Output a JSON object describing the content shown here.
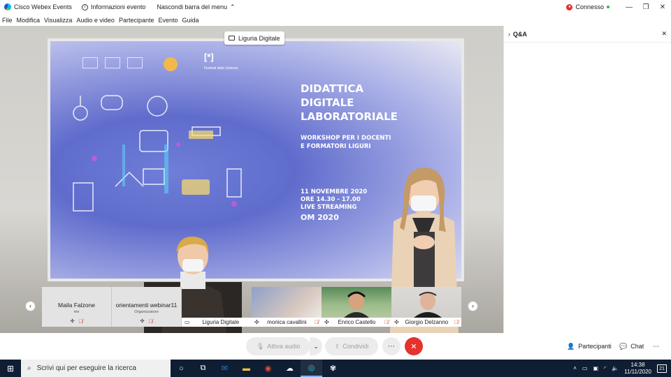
{
  "titlebar": {
    "app_name": "Cisco Webex Events",
    "info_label": "Informazioni evento",
    "hide_menu_label": "Nascondi barra del menu",
    "status_label": "Connesso"
  },
  "menu": [
    "File",
    "Modifica",
    "Visualizza",
    "Audio e video",
    "Partecipante",
    "Evento",
    "Guida"
  ],
  "stage": {
    "tag": "Liguria Digitale",
    "slide": {
      "title": [
        "DIDATTICA",
        "DIGITALE",
        "LABORATORIALE"
      ],
      "subtitle": [
        "WORKSHOP PER I DOCENTI",
        "E FORMATORI LIGURI"
      ],
      "date": [
        "11 NOVEMBRE 2020",
        "ORE 14.30 - 17.00",
        "LIVE STREAMING"
      ],
      "brand": "OM 2020",
      "festival": "Festival della Scienza",
      "festival_mark": "[*]"
    }
  },
  "participants": [
    {
      "name": "Maila Falzone",
      "sub": "me",
      "type": "text"
    },
    {
      "name": "orientamenti webinar11",
      "sub": "Organizzatore",
      "type": "text"
    },
    {
      "name": "Liguria Digitale",
      "type": "video"
    },
    {
      "name": "monica cavallini",
      "type": "video"
    },
    {
      "name": "Enrico Castello",
      "type": "video"
    },
    {
      "name": "Giorgio Delzanno",
      "type": "video"
    }
  ],
  "controls": {
    "audio_label": "Attiva audio",
    "share_label": "Condividi",
    "participants_label": "Partecipanti",
    "chat_label": "Chat"
  },
  "panel": {
    "title": "Q&A"
  },
  "taskbar": {
    "search_placeholder": "Scrivi qui per eseguire la ricerca",
    "time": "14:38",
    "date": "11/11/2020",
    "notification_count": "21"
  }
}
